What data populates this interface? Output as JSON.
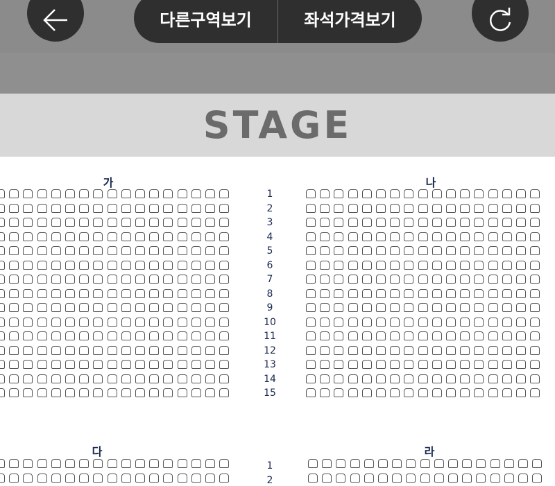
{
  "nav": {
    "back_icon": "arrow-left-icon",
    "refresh_icon": "refresh-icon",
    "other_sections_label": "다른구역보기",
    "seat_prices_label": "좌석가격보기"
  },
  "stage": {
    "label": "STAGE"
  },
  "sections": {
    "ga": "가",
    "na": "나",
    "da": "다",
    "ra": "라"
  },
  "rows_top": [
    "1",
    "2",
    "3",
    "4",
    "5",
    "6",
    "7",
    "8",
    "9",
    "10",
    "11",
    "12",
    "13",
    "14",
    "15"
  ],
  "rows_bottom": [
    "1",
    "2"
  ],
  "colors": {
    "top_bar": "#8b8b8b",
    "button_bg": "#2f2f2f",
    "stage_bg": "#d8d8d8",
    "stage_text": "#6b6b6b",
    "seat_border": "#555555",
    "label_text": "#1a2850"
  }
}
